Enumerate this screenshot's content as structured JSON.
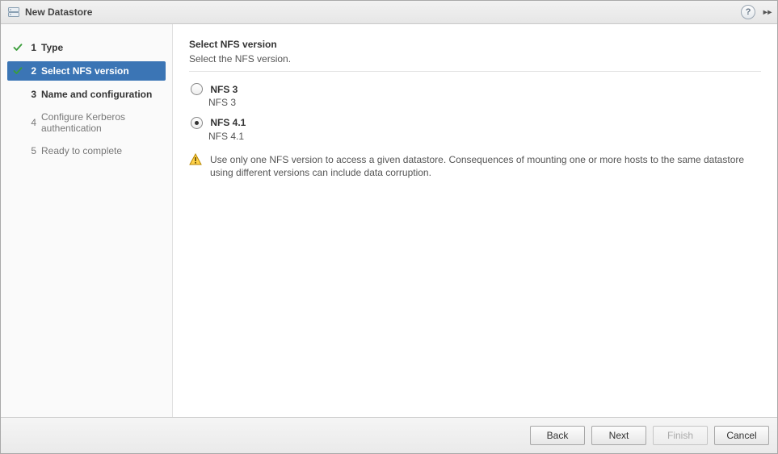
{
  "header": {
    "title": "New Datastore"
  },
  "sidebar": {
    "steps": [
      {
        "num": "1",
        "label": "Type",
        "state": "done"
      },
      {
        "num": "2",
        "label": "Select NFS version",
        "state": "current"
      },
      {
        "num": "3",
        "label": "Name and configuration",
        "state": "enabled"
      },
      {
        "num": "4",
        "label": "Configure Kerberos authentication",
        "state": "future"
      },
      {
        "num": "5",
        "label": "Ready to complete",
        "state": "future"
      }
    ]
  },
  "main": {
    "heading": "Select NFS version",
    "subheading": "Select the NFS version.",
    "options": [
      {
        "label": "NFS 3",
        "description": "NFS 3",
        "selected": false
      },
      {
        "label": "NFS 4.1",
        "description": "NFS 4.1",
        "selected": true
      }
    ],
    "warning": "Use only one NFS version to access a given datastore. Consequences of mounting one or more hosts to the same datastore using different versions can include data corruption."
  },
  "footer": {
    "back": "Back",
    "next": "Next",
    "finish": "Finish",
    "cancel": "Cancel",
    "finish_enabled": false
  }
}
